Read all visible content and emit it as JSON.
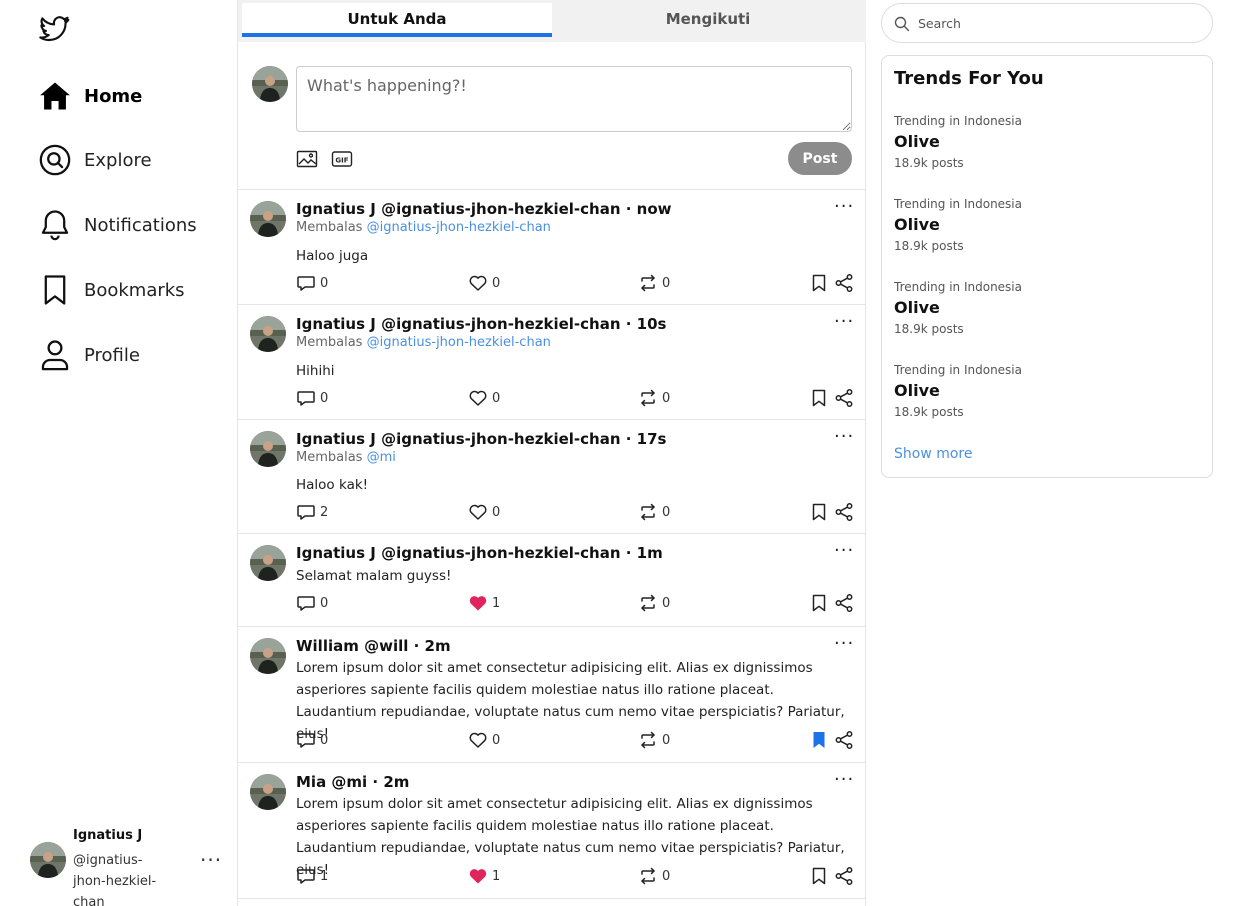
{
  "sidebar": {
    "nav": [
      {
        "label": "Home",
        "icon": "home-icon"
      },
      {
        "label": "Explore",
        "icon": "explore-icon"
      },
      {
        "label": "Notifications",
        "icon": "bell-icon"
      },
      {
        "label": "Bookmarks",
        "icon": "bookmark-icon"
      },
      {
        "label": "Profile",
        "icon": "profile-icon"
      }
    ],
    "user": {
      "name": "Ignatius J",
      "handle": "@ignatius-jhon-hezkiel-chan",
      "more": "···"
    }
  },
  "tabs": {
    "for_you": "Untuk Anda",
    "following": "Mengikuti"
  },
  "composer": {
    "placeholder": "What's happening?!",
    "post_label": "Post",
    "gif_label": "GIF"
  },
  "tweets": [
    {
      "header": "Ignatius J @ignatius-jhon-hezkiel-chan · now",
      "reply_prefix": "Membalas ",
      "reply_to": "@ignatius-jhon-hezkiel-chan",
      "text": "Haloo juga",
      "replies": "0",
      "likes": "0",
      "retweets": "0",
      "liked": false,
      "bookmarked": false
    },
    {
      "header": "Ignatius J @ignatius-jhon-hezkiel-chan · 10s",
      "reply_prefix": "Membalas ",
      "reply_to": "@ignatius-jhon-hezkiel-chan",
      "text": "Hihihi",
      "replies": "0",
      "likes": "0",
      "retweets": "0",
      "liked": false,
      "bookmarked": false
    },
    {
      "header": "Ignatius J @ignatius-jhon-hezkiel-chan · 17s",
      "reply_prefix": "Membalas ",
      "reply_to": "@mi",
      "text": "Haloo kak!",
      "replies": "2",
      "likes": "0",
      "retweets": "0",
      "liked": false,
      "bookmarked": false
    },
    {
      "header": "Ignatius J @ignatius-jhon-hezkiel-chan · 1m",
      "text": "Selamat malam guyss!",
      "replies": "0",
      "likes": "1",
      "retweets": "0",
      "liked": true,
      "bookmarked": false
    },
    {
      "header": "William @will · 2m",
      "text": "Lorem ipsum dolor sit amet consectetur adipisicing elit. Alias ex dignissimos asperiores sapiente facilis quidem molestiae natus illo ratione placeat. Laudantium repudiandae, voluptate natus cum nemo vitae perspiciatis? Pariatur, eius!",
      "replies": "0",
      "likes": "0",
      "retweets": "0",
      "liked": false,
      "bookmarked": true
    },
    {
      "header": "Mia @mi · 2m",
      "text": "Lorem ipsum dolor sit amet consectetur adipisicing elit. Alias ex dignissimos asperiores sapiente facilis quidem molestiae natus illo ratione placeat. Laudantium repudiandae, voluptate natus cum nemo vitae perspiciatis? Pariatur, eius!",
      "replies": "1",
      "likes": "1",
      "retweets": "0",
      "liked": true,
      "bookmarked": false
    }
  ],
  "search": {
    "placeholder": "Search"
  },
  "trends": {
    "title": "Trends For You",
    "items": [
      {
        "context": "Trending in Indonesia",
        "name": "Olive",
        "count": "18.9k posts"
      },
      {
        "context": "Trending in Indonesia",
        "name": "Olive",
        "count": "18.9k posts"
      },
      {
        "context": "Trending in Indonesia",
        "name": "Olive",
        "count": "18.9k posts"
      },
      {
        "context": "Trending in Indonesia",
        "name": "Olive",
        "count": "18.9k posts"
      }
    ],
    "show_more": "Show more"
  },
  "colors": {
    "accent": "#1d72e8",
    "link": "#4a90e2",
    "like": "#e0245e",
    "post_button": "#8c8c8c",
    "tab_bar": "#f1f1f1"
  }
}
